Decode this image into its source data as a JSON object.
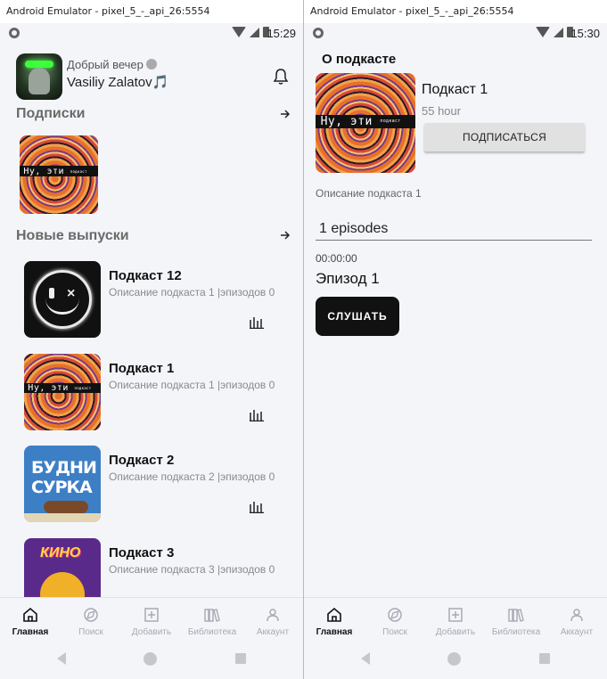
{
  "left": {
    "window_title": "Android Emulator - pixel_5_-_api_26:5554",
    "time": "15:29",
    "greeting": "Добрый вечер",
    "username": "Vasiliy Zalatov",
    "username_emoji": "🎵",
    "subscriptions_title": "Подписки",
    "new_releases_title": "Новые выпуски",
    "cover_text": "Ну, эти",
    "cover_small": "подкаст",
    "episodes": [
      {
        "title": "Подкаст 12",
        "desc": "Описание подкаста 1 |эпизодов 0"
      },
      {
        "title": "Подкаст 1",
        "desc": "Описание подкаста 1 |эпизодов 0"
      },
      {
        "title": "Подкаст 2",
        "desc": "Описание подкаста 2 |эпизодов 0",
        "cover_line1": "БУДНИ",
        "cover_line2": "СУРКА"
      },
      {
        "title": "Подкаст 3",
        "desc": "Описание подкаста 3 |эпизодов 0",
        "cover_word": "КИНО"
      }
    ]
  },
  "right": {
    "window_title": "Android Emulator - pixel_5_-_api_26:5554",
    "time": "15:30",
    "section_title": "О подкасте",
    "podcast_name": "Подкаст 1",
    "hours": "55 hour",
    "subscribe_label": "ПОДПИСАТЬСЯ",
    "description": "Описание подкаста 1",
    "episodes_count": "1 episodes",
    "episode_time": "00:00:00",
    "episode_title": "Эпизод 1",
    "listen_label": "СЛУШАТЬ"
  },
  "nav": {
    "home": "Главная",
    "search": "Поиск",
    "add": "Добавить",
    "library": "Библиотека",
    "account": "Аккаунт"
  },
  "colors": {
    "background": "#f4f5f9",
    "nav_inactive": "#a8aab4",
    "accent_dark": "#111111"
  }
}
